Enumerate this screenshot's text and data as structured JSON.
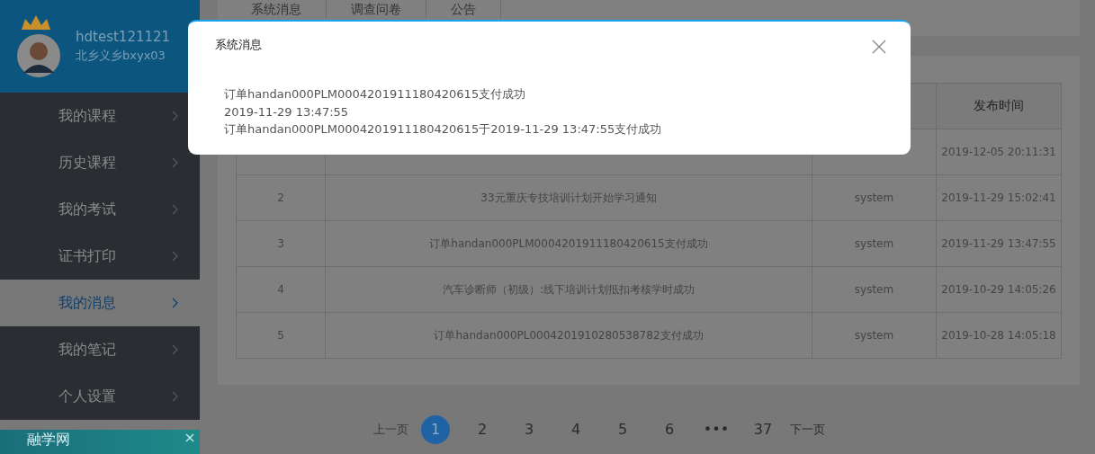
{
  "user": {
    "name": "hdtest121121",
    "org": "北乡义乡bxyx03"
  },
  "nav": [
    {
      "label": "我的课程",
      "selected": false
    },
    {
      "label": "历史课程",
      "selected": false
    },
    {
      "label": "我的考试",
      "selected": false
    },
    {
      "label": "证书打印",
      "selected": false
    },
    {
      "label": "我的消息",
      "selected": true
    },
    {
      "label": "我的笔记",
      "selected": false
    },
    {
      "label": "个人设置",
      "selected": false
    }
  ],
  "ad": {
    "text": "融学网"
  },
  "tabs": [
    {
      "label": "系统消息"
    },
    {
      "label": "调查问卷"
    },
    {
      "label": "公告"
    }
  ],
  "table": {
    "header_time": "发布时间",
    "rows": [
      {
        "time": "2019-12-05 20:11:31"
      },
      {
        "index": "2",
        "title": "33元重庆专技培训计划开始学习通知",
        "publisher": "system",
        "time": "2019-11-29 15:02:41"
      },
      {
        "index": "3",
        "title": "订单handan000PLM0004201911180420615支付成功",
        "publisher": "system",
        "time": "2019-11-29 13:47:55"
      },
      {
        "index": "4",
        "title": "汽车诊断师（初级）:线下培训计划抵扣考核学时成功",
        "publisher": "system",
        "time": "2019-10-29 14:05:26"
      },
      {
        "index": "5",
        "title": "订单handan000PL0004201910280538782支付成功",
        "publisher": "system",
        "time": "2019-10-28 14:05:18"
      }
    ]
  },
  "pagination": {
    "prev": "上一页",
    "next": "下一页",
    "pages": [
      {
        "label": "1",
        "selected": true
      },
      {
        "label": "2",
        "selected": false
      },
      {
        "label": "3",
        "selected": false
      },
      {
        "label": "4",
        "selected": false
      },
      {
        "label": "5",
        "selected": false
      },
      {
        "label": "6",
        "selected": false
      },
      {
        "label": "•••",
        "selected": false
      },
      {
        "label": "37",
        "selected": false
      }
    ]
  },
  "dialog": {
    "title": "系统消息",
    "lines": [
      "订单handan000PLM0004201911180420615支付成功",
      "2019-11-29 13:47:55",
      "订单handan000PLM0004201911180420615于2019-11-29 13:47:55支付成功"
    ]
  }
}
